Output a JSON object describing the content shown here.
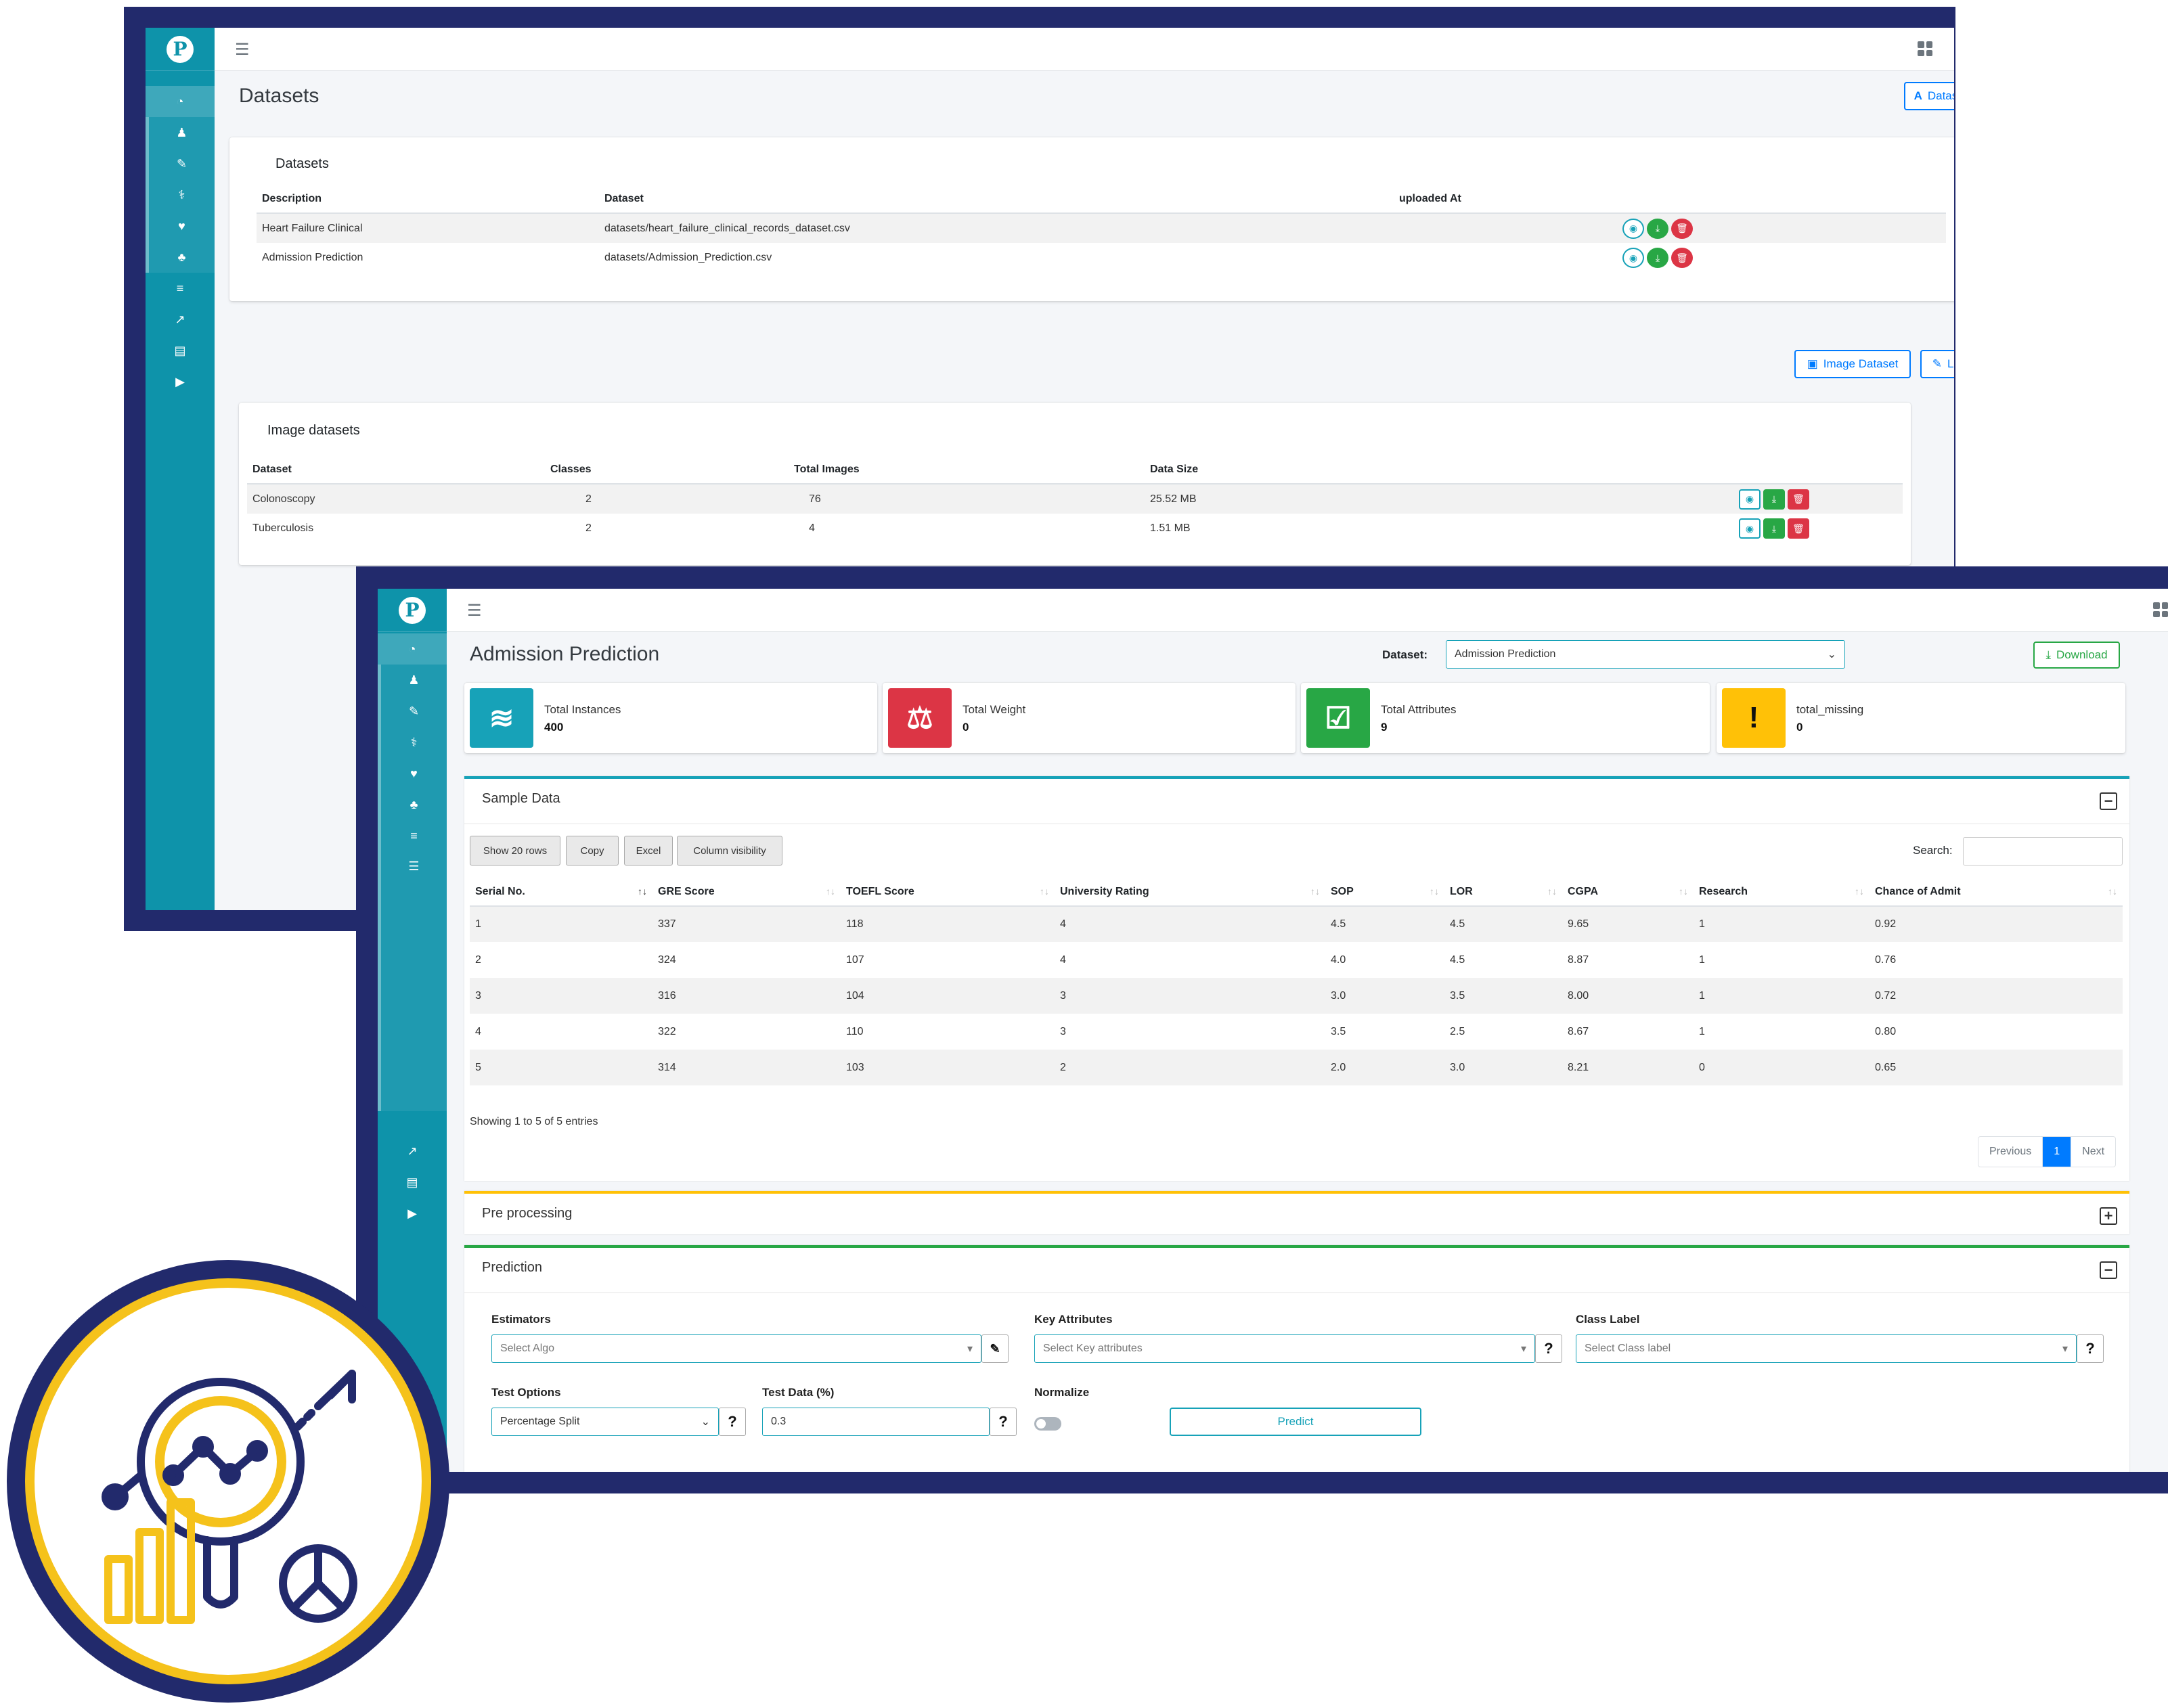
{
  "window1": {
    "page_title": "Datasets",
    "add_dataset_button": "Dataset",
    "datasets_card": {
      "title": "Datasets",
      "columns": [
        "Description",
        "Dataset",
        "uploaded At",
        ""
      ],
      "rows": [
        {
          "description": "Heart Failure Clinical",
          "dataset": "datasets/heart_failure_clinical_records_dataset.csv",
          "uploaded_at": ""
        },
        {
          "description": "Admission Prediction",
          "dataset": "datasets/Admission_Prediction.csv",
          "uploaded_at": ""
        }
      ]
    },
    "image_dataset_button": "Image Dataset",
    "log_button": "Log",
    "image_card": {
      "title": "Image datasets",
      "columns": [
        "Dataset",
        "Classes",
        "Total Images",
        "Data Size",
        ""
      ],
      "rows": [
        {
          "dataset": "Colonoscopy",
          "classes": "2",
          "total_images": "76",
          "data_size": "25.52 MB"
        },
        {
          "dataset": "Tuberculosis",
          "classes": "2",
          "total_images": "4",
          "data_size": "1.51 MB"
        }
      ]
    }
  },
  "window2": {
    "page_title": "Admission Prediction",
    "dataset_label": "Dataset:",
    "dataset_selected": "Admission Prediction",
    "download_button": "Download",
    "info_boxes": [
      {
        "label": "Total Instances",
        "value": "400",
        "color": "#17a2b8",
        "icon": "database-icon"
      },
      {
        "label": "Total Weight",
        "value": "0",
        "color": "#dc3545",
        "icon": "balance-scale-icon"
      },
      {
        "label": "Total Attributes",
        "value": "9",
        "color": "#28a745",
        "icon": "list-check-icon"
      },
      {
        "label": "total_missing",
        "value": "0",
        "color": "#ffc107",
        "icon": "exclamation-icon"
      }
    ],
    "sample_data": {
      "title": "Sample Data",
      "buttons": [
        "Show 20 rows",
        "Copy",
        "Excel",
        "Column visibility"
      ],
      "search_label": "Search:",
      "columns": [
        "Serial No.",
        "GRE Score",
        "TOEFL Score",
        "University Rating",
        "SOP",
        "LOR",
        "CGPA",
        "Research",
        "Chance of Admit"
      ],
      "rows": [
        [
          "1",
          "337",
          "118",
          "4",
          "4.5",
          "4.5",
          "9.65",
          "1",
          "0.92"
        ],
        [
          "2",
          "324",
          "107",
          "4",
          "4.0",
          "4.5",
          "8.87",
          "1",
          "0.76"
        ],
        [
          "3",
          "316",
          "104",
          "3",
          "3.0",
          "3.5",
          "8.00",
          "1",
          "0.72"
        ],
        [
          "4",
          "322",
          "110",
          "3",
          "3.5",
          "2.5",
          "8.67",
          "1",
          "0.80"
        ],
        [
          "5",
          "314",
          "103",
          "2",
          "2.0",
          "3.0",
          "8.21",
          "0",
          "0.65"
        ]
      ],
      "info": "Showing 1 to 5 of 5 entries",
      "pager": {
        "previous": "Previous",
        "current": "1",
        "next": "Next"
      }
    },
    "preprocessing": {
      "title": "Pre processing"
    },
    "prediction": {
      "title": "Prediction",
      "estimators_label": "Estimators",
      "estimators_placeholder": "Select Algo",
      "key_attributes_label": "Key Attributes",
      "key_attributes_placeholder": "Select Key attributes",
      "class_label_label": "Class Label",
      "class_label_placeholder": "Select Class label",
      "test_options_label": "Test Options",
      "test_options_value": "Percentage Split",
      "test_data_label": "Test Data (%)",
      "test_data_value": "0.3",
      "normalize_label": "Normalize",
      "predict_button": "Predict"
    }
  },
  "colors": {
    "frame": "#222a6c",
    "sidebar": "#0e93aa",
    "accent_yellow": "#f5c21b"
  }
}
